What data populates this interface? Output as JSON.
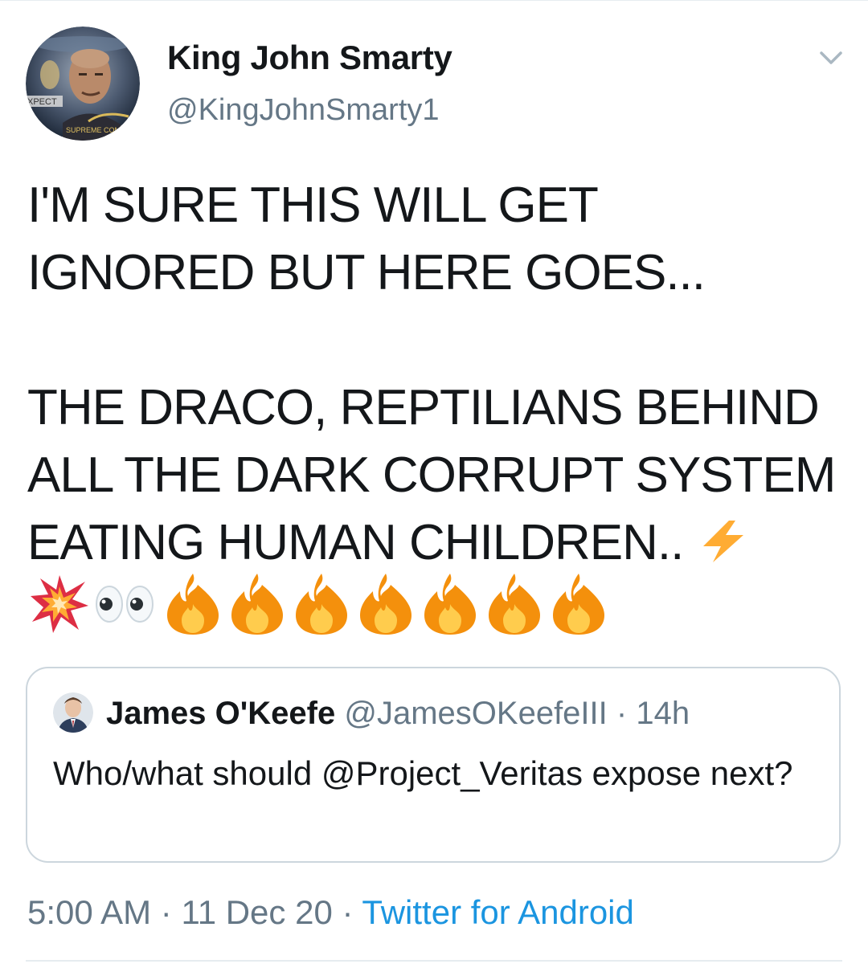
{
  "tweet": {
    "author": {
      "display_name": "King John Smarty",
      "handle": "@KingJohnSmarty1",
      "avatar_icon": "profile-avatar"
    },
    "text": "I'M SURE THIS WILL GET\nIGNORED BUT HERE GOES...\n\nTHE DRACO, REPTILIANS BEHIND\nALL THE DARK CORRUPT SYSTEM\nEATING HUMAN CHILDREN.. ",
    "emojis": [
      "high-voltage-emoji",
      "collision-emoji",
      "eyes-emoji",
      "fire-emoji",
      "fire-emoji",
      "fire-emoji",
      "fire-emoji",
      "fire-emoji",
      "fire-emoji",
      "fire-emoji"
    ],
    "menu_icon": "chevron-down-icon",
    "quoted_tweet": {
      "author_name": "James O'Keefe",
      "handle": "@JamesOKeefeIII",
      "separator": "·",
      "age": "14h",
      "text": "Who/what should @Project_Veritas expose next?"
    },
    "footer": {
      "time": "5:00 AM",
      "date": "11 Dec 20",
      "source": "Twitter for Android",
      "separator": "·"
    },
    "colors": {
      "text": "#14171a",
      "secondary": "#657786",
      "link": "#1b95e0",
      "border": "#ccd6dd"
    }
  }
}
